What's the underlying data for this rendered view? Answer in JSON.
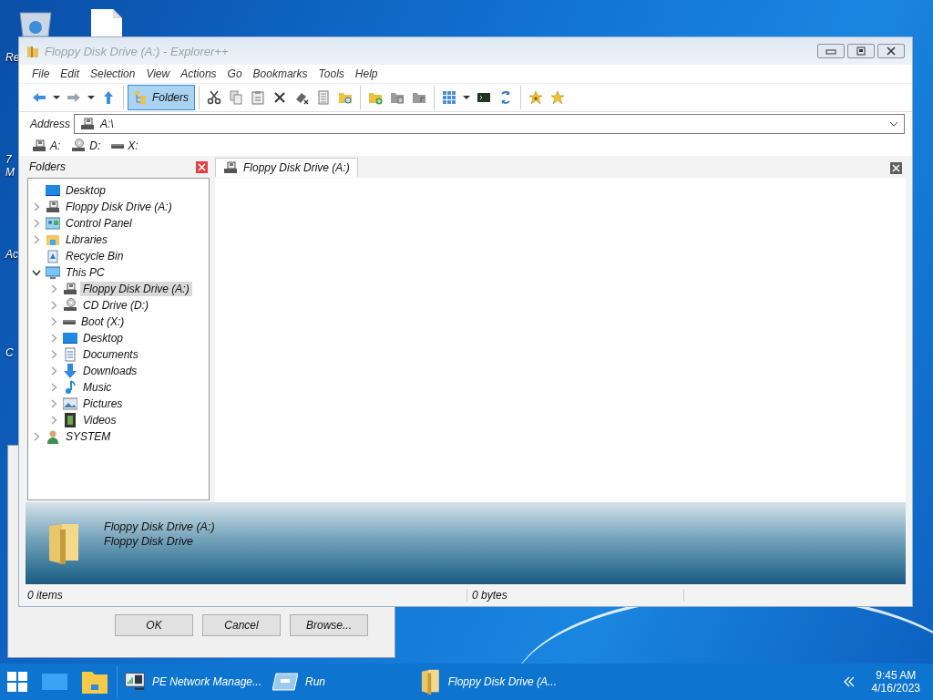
{
  "desktop_icons": [
    {
      "lines": [
        "Re"
      ]
    },
    {
      "lines": [
        "7",
        "M"
      ]
    },
    {
      "lines": [
        "Ac"
      ]
    },
    {
      "lines": [
        "C"
      ]
    }
  ],
  "dialog": {
    "buttons": [
      "OK",
      "Cancel",
      "Browse..."
    ]
  },
  "window": {
    "title": "Floppy Disk Drive (A:) - Explorer++",
    "menu": [
      "File",
      "Edit",
      "Selection",
      "View",
      "Actions",
      "Go",
      "Bookmarks",
      "Tools",
      "Help"
    ],
    "toolbar": [
      {
        "kind": "back"
      },
      {
        "kind": "dropdown"
      },
      {
        "kind": "forward"
      },
      {
        "kind": "dropdown"
      },
      {
        "kind": "up"
      },
      {
        "kind": "separator"
      },
      {
        "kind": "toggle",
        "label": "Folders",
        "selected": true
      },
      {
        "kind": "separator"
      },
      {
        "kind": "cut"
      },
      {
        "kind": "copy"
      },
      {
        "kind": "paste"
      },
      {
        "kind": "delete"
      },
      {
        "kind": "erase"
      },
      {
        "kind": "properties"
      },
      {
        "kind": "search"
      },
      {
        "kind": "separator"
      },
      {
        "kind": "newfolder"
      },
      {
        "kind": "copyto"
      },
      {
        "kind": "moveto"
      },
      {
        "kind": "separator"
      },
      {
        "kind": "views"
      },
      {
        "kind": "dropdown"
      },
      {
        "kind": "console"
      },
      {
        "kind": "refresh"
      },
      {
        "kind": "separator"
      },
      {
        "kind": "addbookmark"
      },
      {
        "kind": "bookmarks"
      }
    ],
    "address": {
      "label": "Address",
      "value": "A:\\"
    },
    "drives": [
      {
        "label": "A:",
        "kind": "floppy"
      },
      {
        "label": "D:",
        "kind": "cd"
      },
      {
        "label": "X:",
        "kind": "disk"
      }
    ],
    "folders_pane": {
      "title": "Folders",
      "tree": [
        {
          "label": "Desktop",
          "kind": "monitor",
          "selected": false,
          "children": [
            {
              "label": "Floppy Disk Drive (A:)",
              "kind": "floppy",
              "expanded": false,
              "selected": false
            },
            {
              "label": "Control Panel",
              "kind": "panel",
              "expanded": false,
              "selected": false
            },
            {
              "label": "Libraries",
              "kind": "library",
              "expanded": false,
              "selected": false
            },
            {
              "label": "Recycle Bin",
              "kind": "recycle",
              "selected": false
            },
            {
              "label": "This PC",
              "kind": "pc",
              "expanded": true,
              "selected": false,
              "children": [
                {
                  "label": "Floppy Disk Drive (A:)",
                  "kind": "floppy",
                  "expanded": false,
                  "selected": true
                },
                {
                  "label": "CD Drive (D:)",
                  "kind": "cd",
                  "expanded": false,
                  "selected": false
                },
                {
                  "label": "Boot (X:)",
                  "kind": "disk",
                  "expanded": false,
                  "selected": false
                },
                {
                  "label": "Desktop",
                  "kind": "monitor",
                  "expanded": false,
                  "selected": false
                },
                {
                  "label": "Documents",
                  "kind": "document",
                  "expanded": false,
                  "selected": false
                },
                {
                  "label": "Downloads",
                  "kind": "download",
                  "expanded": false,
                  "selected": false
                },
                {
                  "label": "Music",
                  "kind": "music",
                  "expanded": false,
                  "selected": false
                },
                {
                  "label": "Pictures",
                  "kind": "picture",
                  "expanded": false,
                  "selected": false
                },
                {
                  "label": "Videos",
                  "kind": "video",
                  "expanded": false,
                  "selected": false
                }
              ]
            },
            {
              "label": "SYSTEM",
              "kind": "user",
              "expanded": false,
              "selected": false
            }
          ]
        }
      ]
    },
    "tabs": [
      {
        "label": "Floppy Disk Drive (A:)",
        "selected": true
      }
    ],
    "display_pane": {
      "lines": [
        "Floppy Disk Drive (A:)",
        "Floppy Disk Drive"
      ]
    },
    "status_bar": [
      "0 items",
      "0 bytes"
    ]
  },
  "taskbar": {
    "apps": [
      {
        "label": "PE Network Manage...",
        "kind": "network"
      },
      {
        "label": "Run",
        "kind": "run"
      },
      {
        "label": "Floppy Disk Drive (A...",
        "kind": "folder"
      }
    ],
    "time": "9:45 AM",
    "date": "4/16/2023"
  }
}
